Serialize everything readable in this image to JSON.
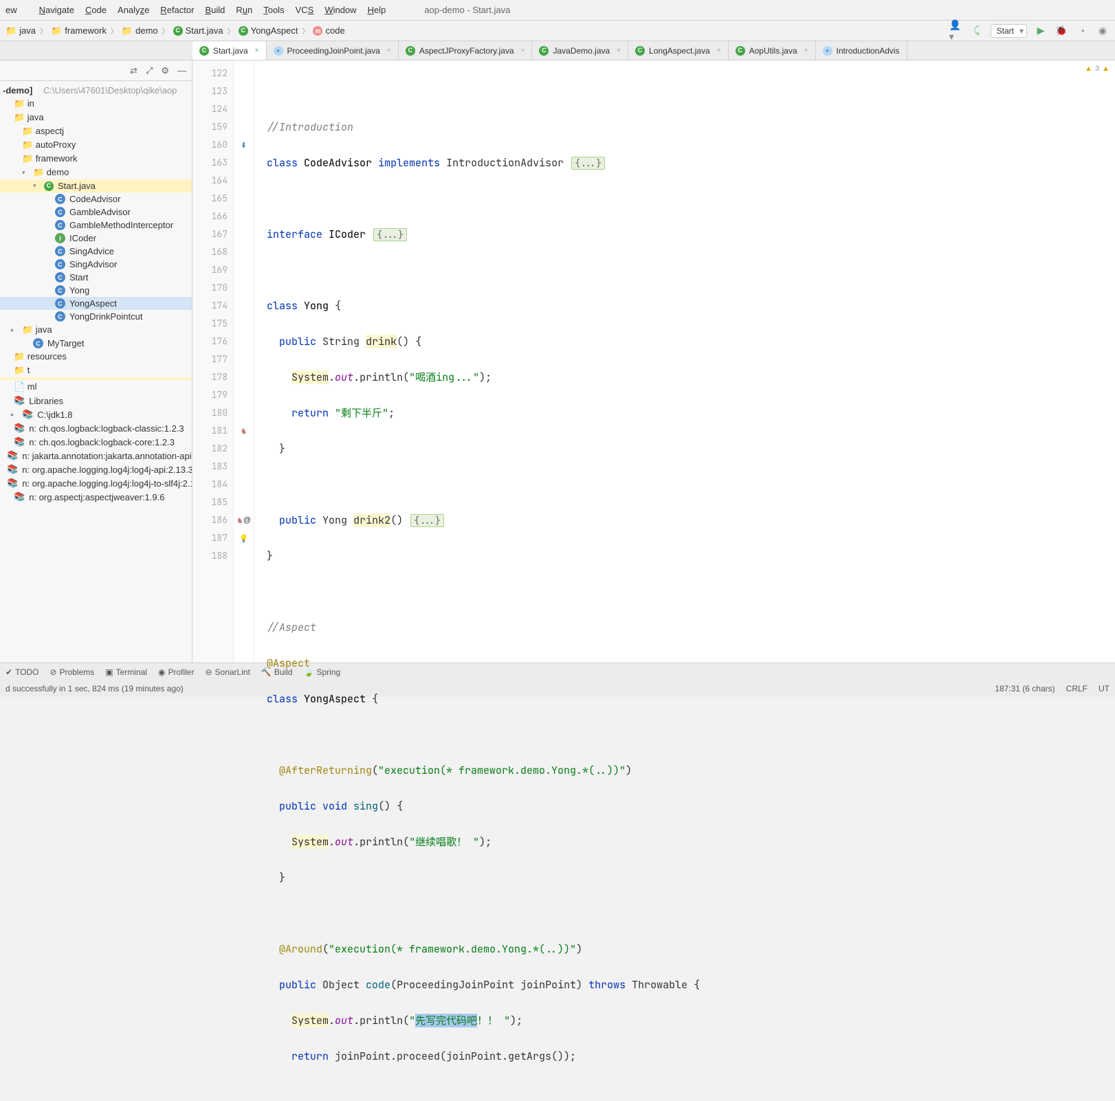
{
  "window_title": "aop-demo - Start.java",
  "menu": [
    "ew",
    "Navigate",
    "Code",
    "Analyze",
    "Refactor",
    "Build",
    "Run",
    "Tools",
    "VCS",
    "Window",
    "Help"
  ],
  "crumbs": [
    {
      "icon": "folder",
      "label": "java"
    },
    {
      "icon": "folder",
      "label": "framework"
    },
    {
      "icon": "folder",
      "label": "demo"
    },
    {
      "icon": "class",
      "label": "Start.java"
    },
    {
      "icon": "class",
      "label": "YongAspect"
    },
    {
      "icon": "method",
      "label": "code"
    }
  ],
  "run_config": "Start",
  "tabs": [
    {
      "label": "Start.java",
      "active": true
    },
    {
      "label": "ProceedingJoinPoint.java",
      "active": false
    },
    {
      "label": "AspectJProxyFactory.java",
      "active": false
    },
    {
      "label": "JavaDemo.java",
      "active": false
    },
    {
      "label": "LongAspect.java",
      "active": false
    },
    {
      "label": "AopUtils.java",
      "active": false
    },
    {
      "label": "IntroductionAdvis",
      "active": false
    }
  ],
  "project_root_label": "-demo]",
  "project_root_path": "C:\\Users\\47601\\Desktop\\qike\\aop",
  "tree": [
    {
      "label": "in",
      "indent": 0,
      "icon": "folder"
    },
    {
      "label": "java",
      "indent": 0,
      "icon": "folder"
    },
    {
      "label": "aspectj",
      "indent": 1,
      "icon": "folder"
    },
    {
      "label": "autoProxy",
      "indent": 1,
      "icon": "folder"
    },
    {
      "label": "framework",
      "indent": 1,
      "icon": "folder"
    },
    {
      "label": "demo",
      "indent": 2,
      "icon": "folder",
      "open": true
    },
    {
      "label": "Start.java",
      "indent": 3,
      "icon": "java",
      "open": true,
      "hl": true
    },
    {
      "label": "CodeAdvisor",
      "indent": 4,
      "icon": "c"
    },
    {
      "label": "GambleAdvisor",
      "indent": 4,
      "icon": "c"
    },
    {
      "label": "GambleMethodInterceptor",
      "indent": 4,
      "icon": "c"
    },
    {
      "label": "ICoder",
      "indent": 4,
      "icon": "i"
    },
    {
      "label": "SingAdvice",
      "indent": 4,
      "icon": "c"
    },
    {
      "label": "SingAdvisor",
      "indent": 4,
      "icon": "c"
    },
    {
      "label": "Start",
      "indent": 4,
      "icon": "c"
    },
    {
      "label": "Yong",
      "indent": 4,
      "icon": "c"
    },
    {
      "label": "YongAspect",
      "indent": 4,
      "icon": "c",
      "sel": true
    },
    {
      "label": "YongDrinkPointcut",
      "indent": 4,
      "icon": "c"
    },
    {
      "label": "java",
      "indent": 1,
      "icon": "folder",
      "collapsed": true
    },
    {
      "label": "MyTarget",
      "indent": 2,
      "icon": "c"
    },
    {
      "label": "resources",
      "indent": 0,
      "icon": "folder"
    },
    {
      "label": "t",
      "indent": 0,
      "icon": "folder"
    },
    {
      "label": "",
      "indent": 0,
      "icon": "none",
      "hl": true
    },
    {
      "label": "ml",
      "indent": 0,
      "icon": "file"
    },
    {
      "label": "Libraries",
      "indent": 0,
      "icon": "lib"
    },
    {
      "label": "C:\\jdk1.8",
      "indent": 1,
      "icon": "lib",
      "collapsed": true
    },
    {
      "label": "n: ch.qos.logback:logback-classic:1.2.3",
      "indent": 0,
      "icon": "lib"
    },
    {
      "label": "n: ch.qos.logback:logback-core:1.2.3",
      "indent": 0,
      "icon": "lib"
    },
    {
      "label": "n: jakarta.annotation:jakarta.annotation-api:1",
      "indent": 0,
      "icon": "lib"
    },
    {
      "label": "n: org.apache.logging.log4j:log4j-api:2.13.3",
      "indent": 0,
      "icon": "lib"
    },
    {
      "label": "n: org.apache.logging.log4j:log4j-to-slf4j:2.1",
      "indent": 0,
      "icon": "lib"
    },
    {
      "label": "n: org.aspectj:aspectjweaver:1.9.6",
      "indent": 0,
      "icon": "lib"
    }
  ],
  "lines": [
    122,
    123,
    124,
    159,
    160,
    163,
    164,
    165,
    166,
    167,
    168,
    169,
    170,
    174,
    175,
    176,
    177,
    178,
    179,
    180,
    181,
    182,
    183,
    184,
    185,
    186,
    187,
    188
  ],
  "code": {
    "l123_cmt": "//Introduction",
    "l124_class": "CodeAdvisor",
    "l124_impl": "IntroductionAdvisor",
    "l160_if": "ICoder",
    "l164_class": "Yong",
    "l165_ret": "String",
    "l165_name": "drink",
    "l166_str": "\"喝酒ing...\"",
    "l167_str": "\"剩下半斤\"",
    "l170_ret": "Yong",
    "l170_name": "drink2",
    "l176_cmt": "//Aspect",
    "l177_ann": "@Aspect",
    "l178_class": "YongAspect",
    "l180_ann": "@AfterReturning",
    "l180_str": "\"execution(* framework.demo.Yong.*(..))\"",
    "l181_name": "sing",
    "l182_str": "\"继续唱歌！ \"",
    "l185_ann": "@Around",
    "l185_str": "\"execution(* framework.demo.Yong.*(..))\"",
    "l186_name": "code",
    "l186_param": "ProceedingJoinPoint joinPoint",
    "l186_throws": "Throwable",
    "l187_sel": "先写完代码吧",
    "l187_rest": "！！ ",
    "l188": "joinPoint.proceed(joinPoint.getArgs());"
  },
  "warn_count": "3",
  "status_items": [
    "TODO",
    "Problems",
    "Terminal",
    "Profiler",
    "SonarLint",
    "Build",
    "Spring"
  ],
  "footer_left": "d successfully in 1 sec, 824 ms (19 minutes ago)",
  "footer_right": [
    "187:31 (6 chars)",
    "CRLF",
    "UT"
  ]
}
